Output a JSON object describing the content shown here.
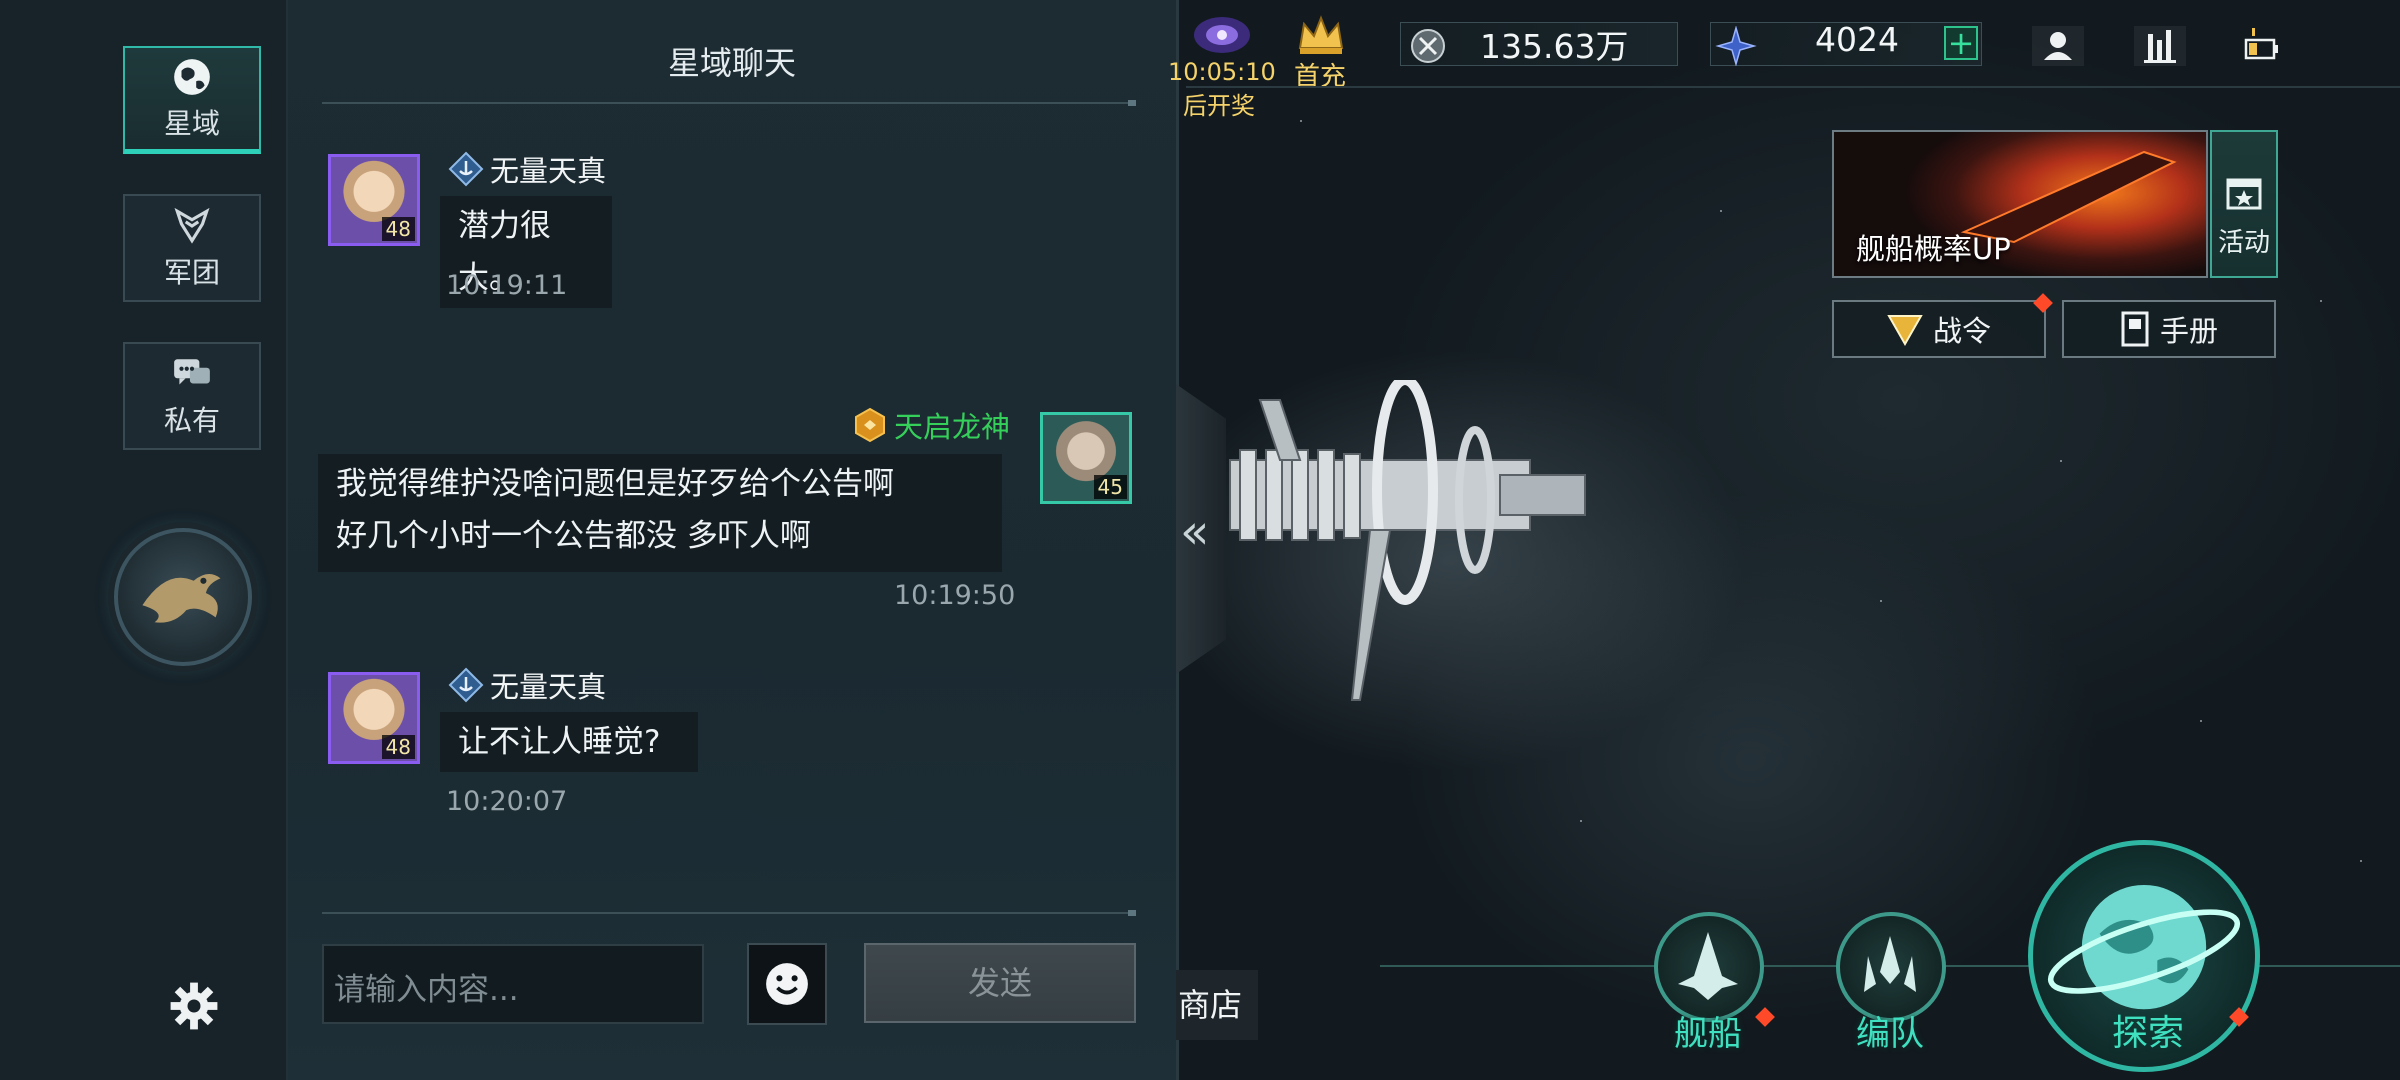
{
  "sidebar": {
    "tabs": [
      {
        "label": "星域",
        "icon": "globe-icon",
        "active": true
      },
      {
        "label": "军团",
        "icon": "legion-emblem-icon",
        "active": false
      },
      {
        "label": "私有",
        "icon": "chat-bubbles-icon",
        "active": false
      }
    ]
  },
  "chat": {
    "title": "星域聊天",
    "messages": [
      {
        "sender": "无量天真",
        "level": "48",
        "text": "潜力很大。",
        "time": "10:19:11",
        "side": "left"
      },
      {
        "sender": "天启龙神",
        "level": "45",
        "text_line1": "我觉得维护没啥问题但是好歹给个公告啊",
        "text_line2": "好几个小时一个公告都没 多吓人啊",
        "time": "10:19:50",
        "side": "right"
      },
      {
        "sender": "无量天真",
        "level": "48",
        "text": "让不让人睡觉?",
        "time": "10:20:07",
        "side": "left"
      }
    ],
    "input_placeholder": "请输入内容...",
    "send_label": "发送"
  },
  "hud": {
    "lottery_timer": "10:05:10",
    "lottery_label": "后开奖",
    "first_pay": "首充",
    "currency1": "135.63万",
    "currency2": "4024"
  },
  "right_panel": {
    "banner_text": "舰船概率UP",
    "activity_label": "活动",
    "battle_pass": "战令",
    "handbook": "手册"
  },
  "bottom_nav": {
    "shop": "商店",
    "ships": "舰船",
    "fleet": "编队",
    "explore": "探索"
  },
  "colors": {
    "accent": "#2fd0b9",
    "vip_name": "#35d05a",
    "gold": "#f6d36a",
    "alert": "#ff4a2a"
  }
}
